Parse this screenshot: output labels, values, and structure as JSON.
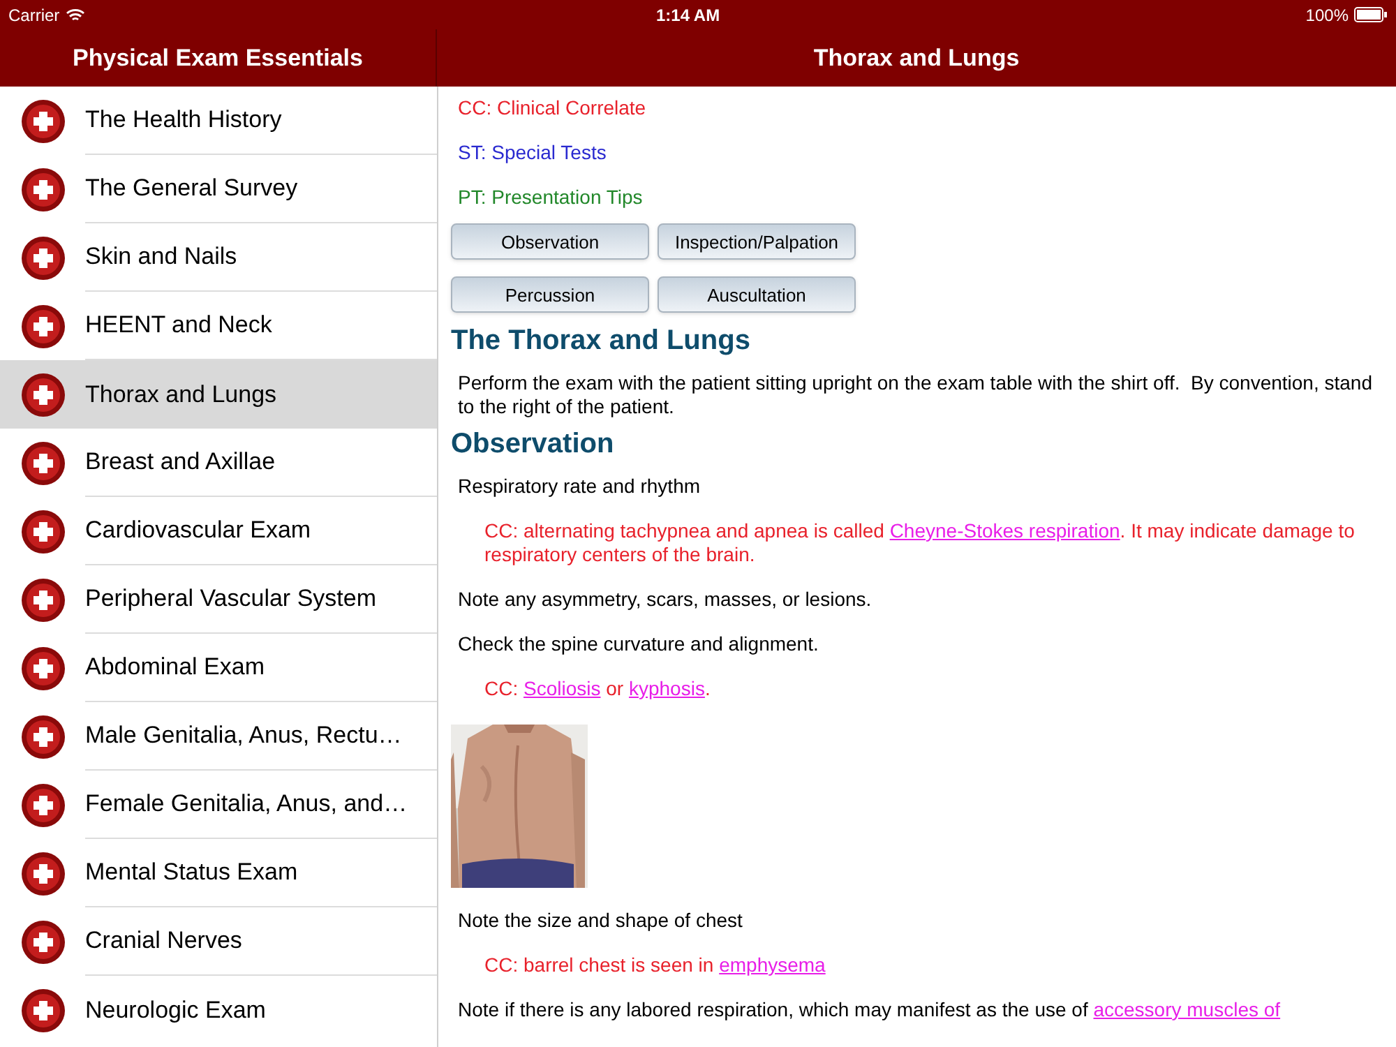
{
  "status_bar": {
    "carrier": "Carrier",
    "time": "1:14 AM",
    "battery": "100%"
  },
  "sidebar": {
    "title": "Physical Exam Essentials",
    "items": [
      {
        "label": "The Health History",
        "selected": false
      },
      {
        "label": "The General Survey",
        "selected": false
      },
      {
        "label": "Skin and Nails",
        "selected": false
      },
      {
        "label": "HEENT and Neck",
        "selected": false
      },
      {
        "label": "Thorax and Lungs",
        "selected": true
      },
      {
        "label": "Breast and Axillae",
        "selected": false
      },
      {
        "label": "Cardiovascular Exam",
        "selected": false
      },
      {
        "label": "Peripheral Vascular System",
        "selected": false
      },
      {
        "label": "Abdominal Exam",
        "selected": false
      },
      {
        "label": "Male Genitalia, Anus, Rectu…",
        "selected": false
      },
      {
        "label": "Female Genitalia, Anus, and…",
        "selected": false
      },
      {
        "label": "Mental Status Exam",
        "selected": false
      },
      {
        "label": "Cranial Nerves",
        "selected": false
      },
      {
        "label": "Neurologic Exam",
        "selected": false
      }
    ]
  },
  "content": {
    "title": "Thorax and Lungs",
    "legend": [
      {
        "text": "CC: Clinical Correlate",
        "color": "#e8212b"
      },
      {
        "text": "ST: Special Tests",
        "color": "#2a2ad0"
      },
      {
        "text": "PT: Presentation Tips",
        "color": "#22882a"
      }
    ],
    "buttons": [
      [
        "Observation",
        "Inspection/Palpation"
      ],
      [
        "Percussion",
        "Auscultation"
      ]
    ],
    "blocks": [
      {
        "kind": "heading",
        "text": "The Thorax and Lungs"
      },
      {
        "kind": "text",
        "segments": [
          {
            "text": "Perform the exam with the patient sitting upright on the exam table with the shirt off.  By convention, stand to the right of the patient."
          }
        ]
      },
      {
        "kind": "heading",
        "text": "Observation"
      },
      {
        "kind": "text",
        "segments": [
          {
            "text": "Respiratory rate and rhythm"
          }
        ]
      },
      {
        "kind": "cc",
        "segments": [
          {
            "text": "CC: alternating tachypnea and apnea is called "
          },
          {
            "text": "Cheyne-Stokes respiration",
            "link": true
          },
          {
            "text": ". It may indicate damage to respiratory centers of the brain."
          }
        ]
      },
      {
        "kind": "text",
        "segments": [
          {
            "text": "Note any asymmetry, scars, masses, or lesions."
          }
        ]
      },
      {
        "kind": "text",
        "segments": [
          {
            "text": "Check the spine curvature and alignment."
          }
        ]
      },
      {
        "kind": "cc",
        "segments": [
          {
            "text": "CC: "
          },
          {
            "text": "Scoliosis",
            "link": true
          },
          {
            "text": " or "
          },
          {
            "text": "kyphosis",
            "link": true
          },
          {
            "text": "."
          }
        ]
      },
      {
        "kind": "picture"
      },
      {
        "kind": "text",
        "segments": [
          {
            "text": "Note the size and shape of chest"
          }
        ]
      },
      {
        "kind": "cc",
        "segments": [
          {
            "text": "CC: barrel chest is seen in "
          },
          {
            "text": "emphysema",
            "link": true
          }
        ]
      },
      {
        "kind": "text",
        "segments": [
          {
            "text": "Note if there is any labored respiration, which may manifest as the use of "
          },
          {
            "text": "accessory muscles of",
            "link": true
          }
        ]
      }
    ]
  }
}
